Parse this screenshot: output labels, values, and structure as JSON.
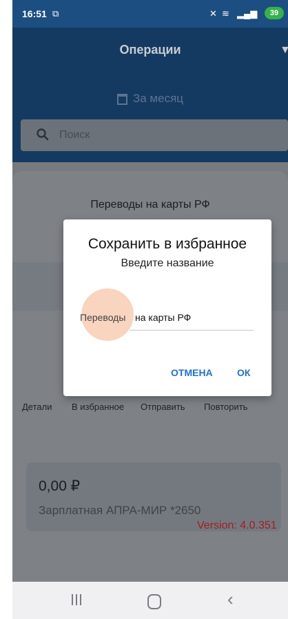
{
  "status_bar": {
    "time": "16:51",
    "battery": "39"
  },
  "header": {
    "title": "Операции",
    "period": "За месяц"
  },
  "search": {
    "placeholder": "Поиск"
  },
  "sheet": {
    "title": "Переводы на карты РФ",
    "actions": [
      "Детали",
      "В избранное",
      "Отправить",
      "Повторить"
    ]
  },
  "card": {
    "amount": "0,00 ₽",
    "name": "Зарплатная АПРА-МИР *2650"
  },
  "version": "Version: 4.0.351",
  "dialog": {
    "title": "Сохранить в избранное",
    "subtitle": "Введите название",
    "field_label": "Переводы",
    "field_value": "на карты РФ",
    "cancel": "ОТМЕНА",
    "ok": "ОК"
  },
  "colors": {
    "header": "#143a62",
    "accent": "#1f6fd6",
    "version": "#a51d1d",
    "battery": "#36b24a"
  }
}
